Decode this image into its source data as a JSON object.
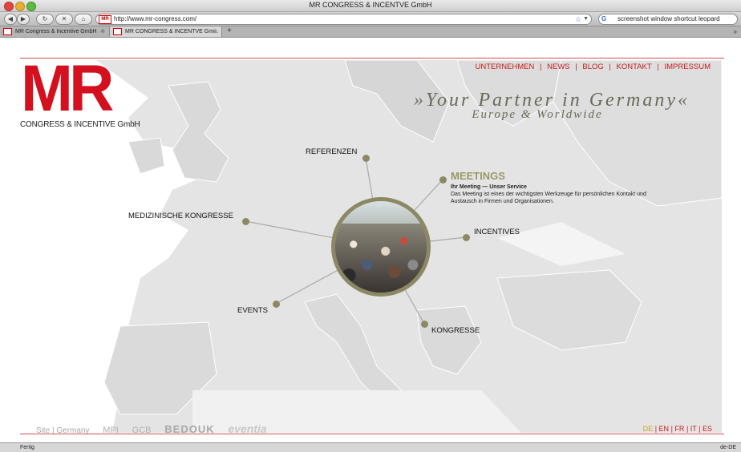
{
  "window": {
    "title": "MR CONGRESS & INCENTVE GmbH"
  },
  "toolbar": {
    "back": "◀",
    "forward": "▶",
    "reload": "↻",
    "stop": "✕",
    "home": "⌂",
    "url": "http://www.mr-congress.com/",
    "url_favicon": "MR",
    "search_engine": "G",
    "search_query": "screenshot window shortcut leopard"
  },
  "tabs": [
    {
      "label": "MR Congress & Incentive GmbH",
      "close": "⊗"
    },
    {
      "label": "MR CONGRESS & INCENTVE Gm...",
      "close": "⊗"
    }
  ],
  "tabs_add": "+",
  "tabs_overflow": "»",
  "site": {
    "logo_text": "MR",
    "logo_subtitle": "CONGRESS & INCENTIVE GmbH",
    "nav": [
      {
        "label": "UNTERNEHMEN"
      },
      {
        "label": "NEWS"
      },
      {
        "label": "BLOG"
      },
      {
        "label": "KONTAKT"
      },
      {
        "label": "IMPRESSUM"
      }
    ],
    "nav_separator": "|",
    "slogan_line1": "»Your Partner in Germany«",
    "slogan_line2": "Europe & Worldwide",
    "hub_links": {
      "referenzen": "REFERENZEN",
      "medizinische": "MEDIZINISCHE KONGRESSE",
      "incentives": "INCENTIVES",
      "events": "EVENTS",
      "kongresse": "KONGRESSE"
    },
    "meetings": {
      "title": "MEETINGS",
      "subtitle": "Ihr Meeting — Unser Service",
      "description": "Das Meeting ist eines der wichtigsten Werkzeuge für persönlichen Kontakt und Austausch in Firmen und Organisationen."
    },
    "partners": {
      "site": "Site | Germany",
      "mpi": "MPI",
      "gcb": "GCB",
      "bedouk": "BEDOUK",
      "eventia": "eventia"
    },
    "languages": [
      "DE",
      "EN",
      "FR",
      "IT",
      "ES"
    ],
    "active_language": "DE"
  },
  "statusbar": {
    "left": "Fertig",
    "right": "de-DE"
  },
  "colors": {
    "brand_red": "#d4101f",
    "accent_olive": "#9c976a",
    "map_gray": "#e3e3e3"
  }
}
